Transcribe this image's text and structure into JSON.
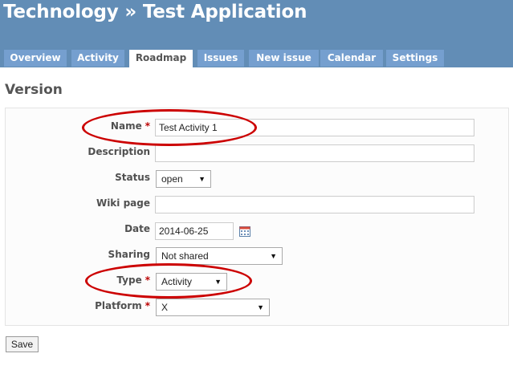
{
  "header": {
    "title": "Technology » Test Application"
  },
  "tabs": [
    {
      "label": "Overview"
    },
    {
      "label": "Activity"
    },
    {
      "label": "Roadmap",
      "selected": true
    },
    {
      "label": "Issues"
    },
    {
      "label": "New issue"
    },
    {
      "label": "Calendar"
    },
    {
      "label": "Settings"
    }
  ],
  "page": {
    "title": "Version"
  },
  "form": {
    "name": {
      "label": "Name",
      "required": "*",
      "value": "Test Activity 1"
    },
    "description": {
      "label": "Description",
      "value": ""
    },
    "status": {
      "label": "Status",
      "value": "open"
    },
    "wiki_page": {
      "label": "Wiki page",
      "value": ""
    },
    "date": {
      "label": "Date",
      "value": "2014-06-25"
    },
    "sharing": {
      "label": "Sharing",
      "value": "Not shared"
    },
    "type": {
      "label": "Type",
      "required": "*",
      "value": "Activity"
    },
    "platform": {
      "label": "Platform",
      "required": "*",
      "value": "X"
    },
    "save_label": "Save"
  },
  "colors": {
    "header": "#628db6",
    "tab": "#759fcf",
    "annotation": "#cc0000",
    "required": "#bb0000"
  },
  "icons": {
    "calendar": "calendar-icon",
    "dropdown": "chevron-down-icon"
  }
}
